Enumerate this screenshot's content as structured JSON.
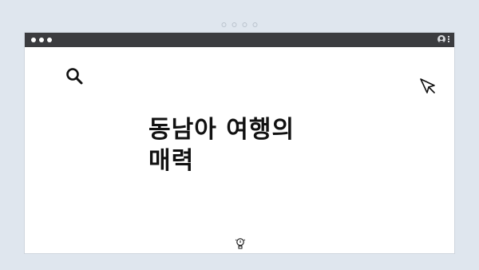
{
  "carousel": {
    "dot_count": 4
  },
  "window": {
    "titlebar_color": "#3b3c3f",
    "controls": [
      "close",
      "minimize",
      "maximize"
    ],
    "right_icons": [
      "user-icon",
      "kebab-menu-icon"
    ]
  },
  "content": {
    "headline": "동남아 여행의\n매력",
    "icons": [
      "search-icon",
      "cursor-icon",
      "lightbulb-icon"
    ]
  },
  "colors": {
    "background": "#dfe6ee",
    "card": "#ffffff",
    "text": "#111111"
  }
}
